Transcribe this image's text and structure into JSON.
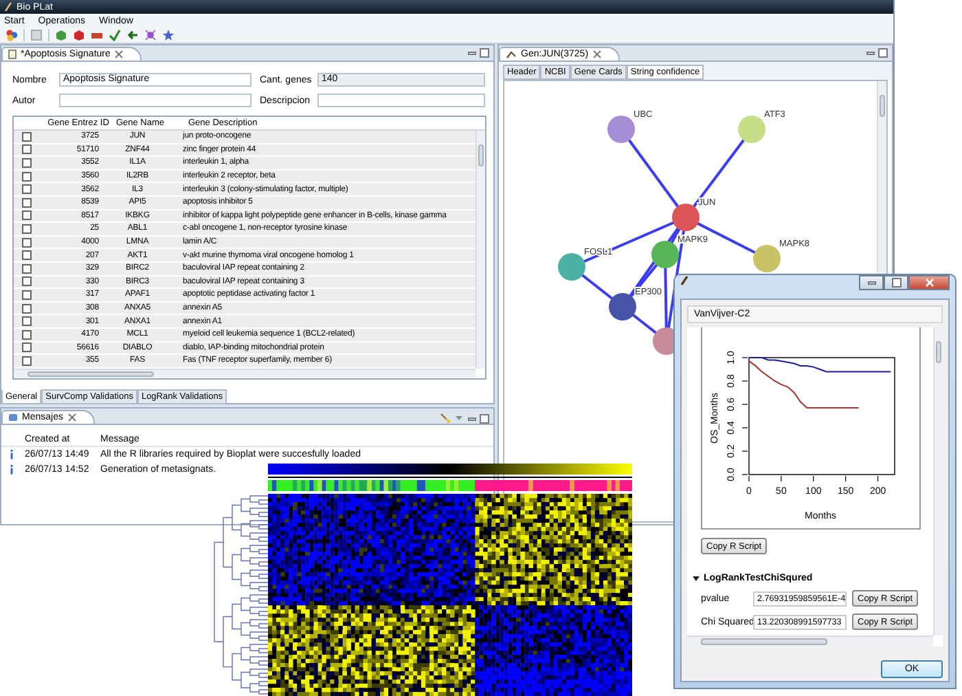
{
  "window": {
    "title": "Bio PLat"
  },
  "menu": [
    "Start",
    "Operations",
    "Window"
  ],
  "editor": {
    "tab": "*Apoptosis Signature",
    "fields": [
      {
        "label": "Nombre",
        "value": "Apoptosis Signature",
        "disabled": false
      },
      {
        "label": "Cant. genes",
        "value": "140",
        "disabled": true
      },
      {
        "label": "Autor",
        "disabled": false
      },
      {
        "label": "Descripcion",
        "disabled": false
      }
    ],
    "table": {
      "columns": [
        "Gene Entrez ID",
        "Gene Name",
        "Gene Description"
      ],
      "rows": [
        {
          "checked": false,
          "cells": [
            "3725",
            "JUN",
            "jun proto-oncogene"
          ]
        },
        {
          "checked": false,
          "cells": [
            "51710",
            "ZNF44",
            "zinc finger protein 44"
          ]
        },
        {
          "checked": false,
          "cells": [
            "3552",
            "IL1A",
            "interleukin 1, alpha"
          ]
        },
        {
          "checked": false,
          "cells": [
            "3560",
            "IL2RB",
            "interleukin 2 receptor, beta"
          ]
        },
        {
          "checked": false,
          "cells": [
            "3562",
            "IL3",
            "interleukin 3 (colony-stimulating factor, multiple)"
          ]
        },
        {
          "checked": false,
          "cells": [
            "8539",
            "API5",
            "apoptosis inhibitor 5"
          ]
        },
        {
          "checked": false,
          "cells": [
            "8517",
            "IKBKG",
            "inhibitor of kappa light polypeptide gene enhancer in B-cells, kinase gamma"
          ]
        },
        {
          "checked": false,
          "cells": [
            "25",
            "ABL1",
            "c-abl oncogene 1, non-receptor tyrosine kinase"
          ]
        },
        {
          "checked": false,
          "cells": [
            "4000",
            "LMNA",
            "lamin A/C"
          ]
        },
        {
          "checked": false,
          "cells": [
            "207",
            "AKT1",
            "v-akt murine thymoma viral oncogene homolog 1"
          ]
        },
        {
          "checked": false,
          "cells": [
            "329",
            "BIRC2",
            "baculoviral IAP repeat containing 2"
          ]
        },
        {
          "checked": false,
          "cells": [
            "330",
            "BIRC3",
            "baculoviral IAP repeat containing 3"
          ]
        },
        {
          "checked": false,
          "cells": [
            "317",
            "APAF1",
            "apoptotic peptidase activating factor 1"
          ]
        },
        {
          "checked": false,
          "cells": [
            "308",
            "ANXA5",
            "annexin A5"
          ]
        },
        {
          "checked": false,
          "cells": [
            "301",
            "ANXA1",
            "annexin A1"
          ]
        },
        {
          "checked": false,
          "cells": [
            "4170",
            "MCL1",
            "myeloid cell leukemia sequence 1 (BCL2-related)"
          ]
        },
        {
          "checked": false,
          "cells": [
            "56616",
            "DIABLO",
            "diablo, IAP-binding mitochondrial protein"
          ]
        },
        {
          "checked": false,
          "cells": [
            "355",
            "FAS",
            "Fas (TNF receptor superfamily, member 6)"
          ]
        }
      ]
    },
    "bottom_tabs": [
      {
        "label": "General",
        "selected": true
      },
      {
        "label": "SurvComp Validations",
        "selected": false
      },
      {
        "label": "LogRank Validations",
        "selected": false
      }
    ]
  },
  "messages": {
    "tab": "Mensajes",
    "columns": [
      "Created at",
      "Message"
    ],
    "rows": [
      {
        "time": "26/07/13 14:49",
        "message": "All the R libraries required by Bioplat were succesfully loaded"
      },
      {
        "time": "26/07/13 14:52",
        "message": "Generation of metasignats."
      }
    ]
  },
  "gene": {
    "tab": "Gen:JUN(3725)",
    "tabs": [
      {
        "label": "Header",
        "selected": false
      },
      {
        "label": "NCBI",
        "selected": false
      },
      {
        "label": "Gene Cards",
        "selected": false
      },
      {
        "label": "String confidence",
        "selected": true
      }
    ],
    "nodes": [
      {
        "label": "UBC",
        "color": "#a58ed6"
      },
      {
        "label": "ATF3",
        "color": "#c4df86"
      },
      {
        "label": "JUN",
        "color": "#de5557"
      },
      {
        "label": "MAPK9",
        "color": "#58b558"
      },
      {
        "label": "MAPK8",
        "color": "#c8c466"
      },
      {
        "label": "FOSL1",
        "color": "#4cb0a3"
      },
      {
        "label": "EP300",
        "color": "#4852a6"
      },
      {
        "color": "#c98a9a"
      }
    ]
  },
  "dialog": {
    "group": "VanVijver-C2",
    "chart_data": {
      "type": "line",
      "xlabel": "Months",
      "ylabel": "OS_Months",
      "x": [
        0,
        10,
        20,
        30,
        40,
        50,
        60,
        70,
        80,
        90,
        100,
        110,
        120,
        150,
        170,
        220
      ],
      "series": [
        {
          "color": "#1f1f9e",
          "values": [
            1,
            1,
            1,
            0.98,
            0.98,
            0.97,
            0.96,
            0.95,
            0.93,
            0.93,
            0.92,
            0.9,
            0.88,
            0.88,
            0.88,
            0.88
          ]
        },
        {
          "color": "#a83232",
          "values": [
            0.97,
            0.93,
            0.88,
            0.84,
            0.8,
            0.77,
            0.75,
            0.7,
            0.62,
            0.57,
            0.57,
            0.57,
            0.57,
            0.57,
            0.57,
            null
          ]
        }
      ],
      "xlim": [
        0,
        226
      ],
      "ylim": [
        0,
        1
      ],
      "xticks": [
        0,
        50,
        100,
        150,
        200
      ],
      "yticks": [
        {
          "value": 0,
          "label": "0.0"
        },
        {
          "value": 0.2,
          "label": "0.2"
        },
        {
          "value": 0.4,
          "label": "0.4"
        },
        {
          "value": 0.6,
          "label": "0.6"
        },
        {
          "value": 0.8,
          "label": "0.8"
        },
        {
          "value": 1,
          "label": "1.0"
        }
      ]
    },
    "copy_button": "Copy R Script",
    "section": {
      "title": "LogRankTestChiSqured",
      "expanded": true,
      "rows": [
        {
          "label": "pvalue",
          "value": "2.76931959859561E-4",
          "button": "Copy R Script"
        },
        {
          "label": "Chi Squared",
          "value": "13.220308991597733",
          "button": "Copy R Script"
        }
      ]
    },
    "ok_button": "OK"
  }
}
